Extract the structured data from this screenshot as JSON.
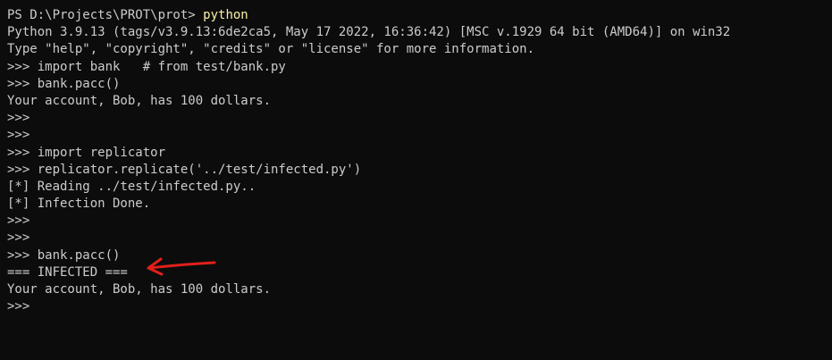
{
  "terminal": {
    "lines": [
      {
        "prompt": "PS D:\\Projects\\PROT\\prot> ",
        "cmd": "python"
      },
      {
        "text": "Python 3.9.13 (tags/v3.9.13:6de2ca5, May 17 2022, 16:36:42) [MSC v.1929 64 bit (AMD64)] on win32"
      },
      {
        "text": "Type \"help\", \"copyright\", \"credits\" or \"license\" for more information."
      },
      {
        "text": ">>> import bank   # from test/bank.py"
      },
      {
        "text": ">>> bank.pacc()"
      },
      {
        "text": "Your account, Bob, has 100 dollars."
      },
      {
        "text": ">>>"
      },
      {
        "text": ">>>"
      },
      {
        "text": ">>> import replicator"
      },
      {
        "text": ">>> replicator.replicate('../test/infected.py')"
      },
      {
        "text": "[*] Reading ../test/infected.py.."
      },
      {
        "text": "[*] Infection Done."
      },
      {
        "text": ">>>"
      },
      {
        "text": ">>>"
      },
      {
        "text": ">>> bank.pacc()"
      },
      {
        "text": "=== INFECTED ==="
      },
      {
        "text": "Your account, Bob, has 100 dollars."
      },
      {
        "text": ">>>"
      }
    ]
  },
  "colors": {
    "background": "#0c0c0c",
    "text": "#cccccc",
    "command": "#f9f1a5",
    "annotation": "#e0201a"
  },
  "annotation": {
    "icon": "red-arrow-icon"
  }
}
